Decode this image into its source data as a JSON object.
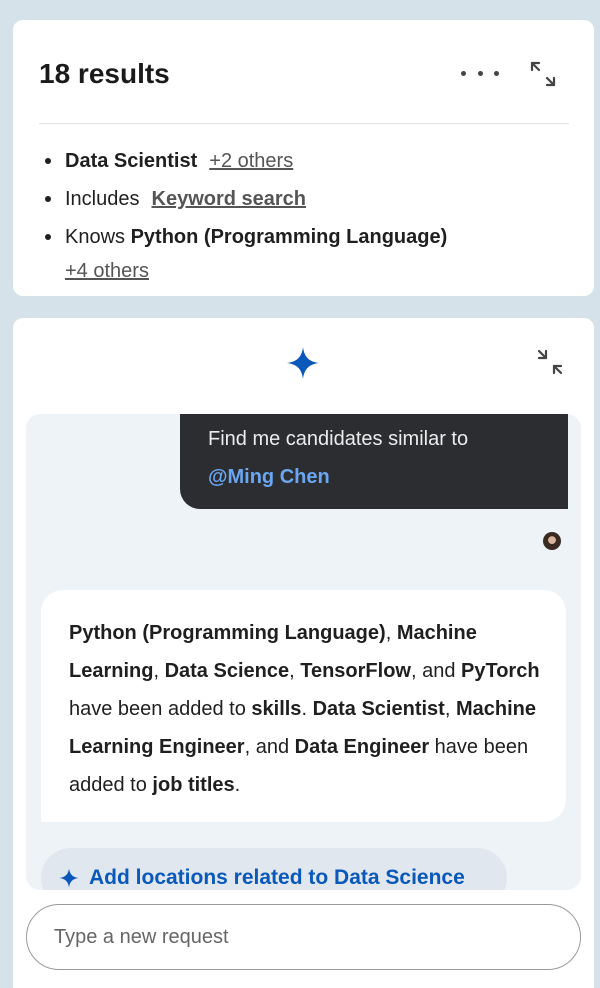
{
  "results": {
    "title": "18 results",
    "filters": [
      {
        "bold": "Data Scientist",
        "link": "+2 others"
      },
      {
        "prefix": "Includes",
        "link": "Keyword search"
      },
      {
        "prefix": "Knows",
        "bold": "Python (Programming Language)",
        "link": "+4 others"
      }
    ],
    "icons": {
      "more": "more-horizontal-icon",
      "expand": "expand-icon"
    }
  },
  "assistant": {
    "icons": {
      "header": "sparkle-icon",
      "collapse": "collapse-icon",
      "chip": "sparkle-icon"
    },
    "user_message": {
      "text": "Find me candidates similar to",
      "mention": "@Ming Chen"
    },
    "bot_message": {
      "parts": [
        {
          "text": "Python (Programming Language)",
          "bold": true
        },
        {
          "text": ", ",
          "bold": false
        },
        {
          "text": "Machine Learning",
          "bold": true
        },
        {
          "text": ", ",
          "bold": false
        },
        {
          "text": "Data Science",
          "bold": true
        },
        {
          "text": ", ",
          "bold": false
        },
        {
          "text": "TensorFlow",
          "bold": true
        },
        {
          "text": ", and ",
          "bold": false
        },
        {
          "text": "PyTorch",
          "bold": true
        },
        {
          "text": " have been added to ",
          "bold": false
        },
        {
          "text": "skills",
          "bold": true
        },
        {
          "text": ". ",
          "bold": false
        },
        {
          "text": "Data Scientist",
          "bold": true
        },
        {
          "text": ", ",
          "bold": false
        },
        {
          "text": "Machine Learning Engineer",
          "bold": true
        },
        {
          "text": ", and ",
          "bold": false
        },
        {
          "text": "Data Engineer",
          "bold": true
        },
        {
          "text": " have been added to ",
          "bold": false
        },
        {
          "text": "job titles",
          "bold": true
        },
        {
          "text": ".",
          "bold": false
        }
      ]
    },
    "suggestion": "Add locations related to Data Science",
    "input_placeholder": "Type a new request"
  },
  "colors": {
    "page_bg": "#d5e2ea",
    "user_bubble": "#2b2d30",
    "mention": "#6aa6f2",
    "accent": "#0a58ba",
    "chip_bg": "#e1e7ee"
  }
}
